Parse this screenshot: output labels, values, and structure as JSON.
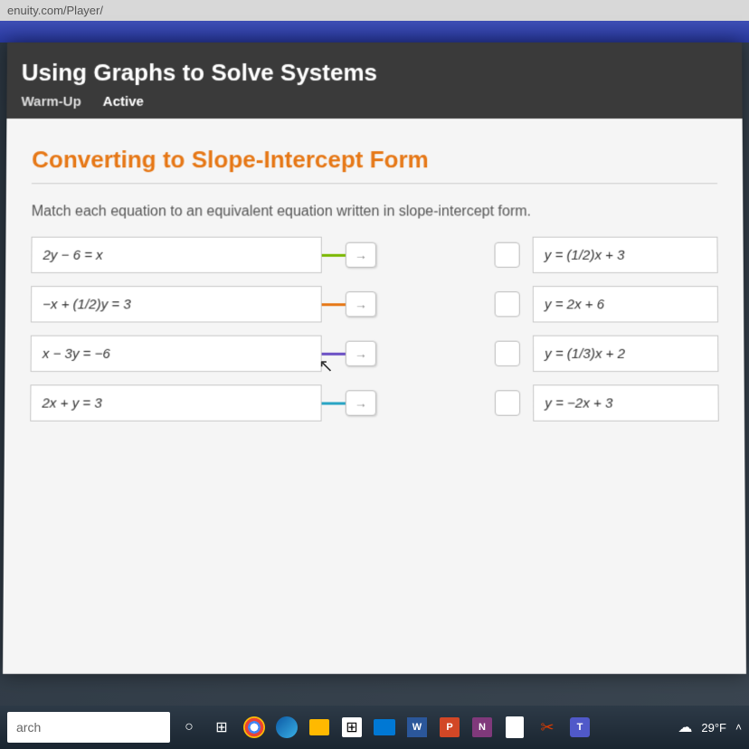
{
  "browser": {
    "url": "enuity.com/Player/"
  },
  "header": {
    "lesson_title": "Using Graphs to Solve Systems",
    "tabs": [
      "Warm-Up",
      "Active"
    ]
  },
  "content": {
    "section_title": "Converting to Slope-Intercept Form",
    "instruction": "Match each equation to an equivalent equation written in slope-intercept form.",
    "left_equations": [
      "2y − 6 = x",
      "−x + (1/2)y = 3",
      "x − 3y = −6",
      "2x + y = 3"
    ],
    "right_equations": [
      "y = (1/2)x + 3",
      "y = 2x + 6",
      "y = (1/3)x + 2",
      "y = −2x + 3"
    ],
    "connector_colors": [
      "#7ab800",
      "#e67817",
      "#6a4fc4",
      "#2aa5c4"
    ]
  },
  "taskbar": {
    "search_placeholder": "arch",
    "weather_temp": "29°F",
    "apps": {
      "word": "W",
      "ppt": "P",
      "onenote": "N",
      "teams": "T"
    }
  }
}
